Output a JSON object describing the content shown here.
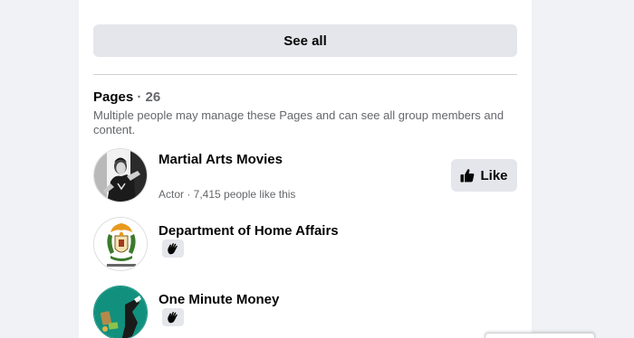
{
  "see_all": {
    "label": "See all"
  },
  "pages_section": {
    "title": "Pages",
    "separator": "·",
    "count": "26",
    "description": "Multiple people may manage these Pages and can see all group members and content."
  },
  "pages": [
    {
      "name": "Martial Arts Movies",
      "meta": "Actor · 7,415 people like this",
      "action_label": "Like",
      "action_icon": "thumbs-up-icon",
      "avatar_icon": "martial-arts-avatar"
    },
    {
      "name": "Department of Home Affairs",
      "badge_icon": "wave-icon",
      "avatar_icon": "coat-of-arms-avatar"
    },
    {
      "name": "One Minute Money",
      "badge_icon": "wave-icon",
      "avatar_icon": "one-minute-money-avatar"
    }
  ],
  "colors": {
    "button_bg": "#e4e6eb",
    "secondary_text": "#65676b",
    "divider": "#ced0d4",
    "page_bg": "#f0f2f5",
    "teal": "#12907e"
  }
}
